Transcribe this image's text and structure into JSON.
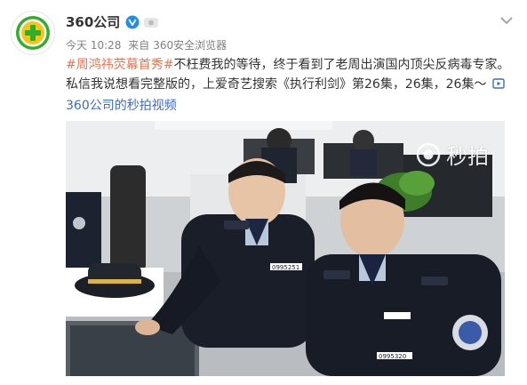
{
  "author": {
    "name": "360公司",
    "avatar_icon": "360-logo-icon",
    "verified_icon": "verified-badge-icon",
    "vip_icon": "vip-badge-icon"
  },
  "meta": {
    "time": "今天 10:28",
    "source_prefix": "来自",
    "source": "360安全浏览器"
  },
  "post": {
    "hashtag": "#周鸿祎荧幕首秀#",
    "text_line1_rest": "不枉费我的等待，终于看到了老周出演国内顶尖反病毒专家。",
    "text_line2": "私信我说想看完整版的，上爱奇艺搜索《执行利剑》第26集，26集，26集～",
    "video_link": "360公司的秒拍视频",
    "video_icon": "video-play-icon"
  },
  "media": {
    "watermark": "秒拍",
    "watermark_icon": "camera-lens-icon",
    "badge_left": "0995251",
    "badge_right": "0995320"
  },
  "menu_icon": "chevron-down-icon"
}
